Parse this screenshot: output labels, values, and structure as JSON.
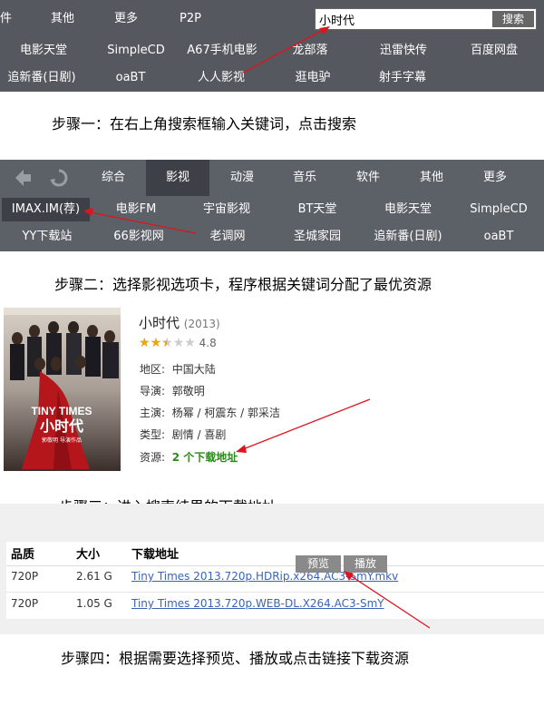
{
  "step1": {
    "nav_top": [
      "件",
      "其他",
      "更多",
      "P2P"
    ],
    "search": {
      "value": "小时代",
      "button": "搜索"
    },
    "sites_row1": [
      "电影天堂",
      "SimpleCD",
      "A67手机电影",
      "龙部落",
      "迅雷快传",
      "百度网盘"
    ],
    "sites_row2": [
      "追新番(日剧)",
      "oaBT",
      "人人影视",
      "逛电驴",
      "射手字幕"
    ],
    "caption": "步骤一：在右上角搜索框输入关键词，点击搜索"
  },
  "step2": {
    "tabs": [
      "综合",
      "影视",
      "动漫",
      "音乐",
      "软件",
      "其他",
      "更多"
    ],
    "active_tab": "影视",
    "sites_row1": [
      "IMAX.IM(荐)",
      "电影FM",
      "宇宙影视",
      "BT天堂",
      "电影天堂",
      "SimpleCD"
    ],
    "sites_row2": [
      "YY下载站",
      "66影视网",
      "老调网",
      "圣城家园",
      "追新番(日剧)",
      "oaBT"
    ],
    "caption": "步骤二：选择影视选项卡，程序根据关键词分配了最优资源"
  },
  "movie": {
    "poster_title": "TINY TIMES",
    "poster_subtitle": "小时代",
    "poster_credit": "郭敬明 导演作品",
    "title": "小时代",
    "year": "(2013)",
    "rating": "4.8",
    "stars": 2.5,
    "region_label": "地区:",
    "region": "中国大陆",
    "director_label": "导演:",
    "director": "郭敬明",
    "cast_label": "主演:",
    "cast": "杨幂 / 柯震东 / 郭采洁",
    "genre_label": "类型:",
    "genre": "剧情 / 喜剧",
    "source_label": "资源:",
    "source": "2 个下载地址",
    "caption": "步骤三：进入搜索结果的下载地址"
  },
  "downloads": {
    "headers": [
      "品质",
      "大小",
      "下载地址"
    ],
    "rows": [
      {
        "quality": "720P",
        "size": "2.61 G",
        "link": "Tiny Times 2013.720p.HDRip.x264.AC3-SmY.mkv"
      },
      {
        "quality": "720P",
        "size": "1.05 G",
        "link": "Tiny Times 2013.720p.WEB-DL.X264.AC3-SmY"
      }
    ],
    "preview_button": "预览",
    "play_button": "播放",
    "caption": "步骤四：根据需要选择预览、播放或点击链接下载资源"
  },
  "colors": {
    "nav_bg": "#55595f",
    "active": "#3d4147",
    "link": "#3b63b8",
    "source": "#2a8a1a",
    "arrow": "#e0141e"
  }
}
